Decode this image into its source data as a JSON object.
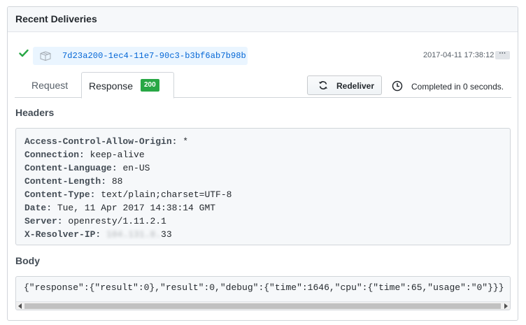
{
  "panel": {
    "title": "Recent Deliveries"
  },
  "delivery": {
    "guid": "7d23a200-1ec4-11e7-90c3-b3bf6ab7b98b",
    "timestamp": "2017-04-11 17:38:12",
    "menu_label": "···",
    "status_icon": "check-icon",
    "status_color": "#28a745"
  },
  "tabs": [
    {
      "label": "Request",
      "selected": false
    },
    {
      "label": "Response",
      "selected": true,
      "badge": "200"
    }
  ],
  "redeliver_label": "Redeliver",
  "completed_text": "Completed in 0 seconds.",
  "headers_title": "Headers",
  "headers": [
    {
      "key": "Access-Control-Allow-Origin:",
      "value": "*"
    },
    {
      "key": "Connection:",
      "value": "keep-alive"
    },
    {
      "key": "Content-Language:",
      "value": "en-US"
    },
    {
      "key": "Content-Length:",
      "value": "88"
    },
    {
      "key": "Content-Type:",
      "value": "text/plain;charset=UTF-8"
    },
    {
      "key": "Date:",
      "value": "Tue, 11 Apr 2017 14:38:14 GMT"
    },
    {
      "key": "Server:",
      "value": "openresty/1.11.2.1"
    },
    {
      "key": "X-Resolver-IP:",
      "value_blurred": "104.131.8.",
      "value": "33"
    }
  ],
  "body_title": "Body",
  "body_text": "{\"response\":{\"result\":0},\"result\":0,\"debug\":{\"time\":1646,\"cpu\":{\"time\":65,\"usage\":\"0\"}}}",
  "colors": {
    "accent": "#0366d6",
    "success": "#28a745",
    "guid_bg": "#eaf5ff"
  }
}
